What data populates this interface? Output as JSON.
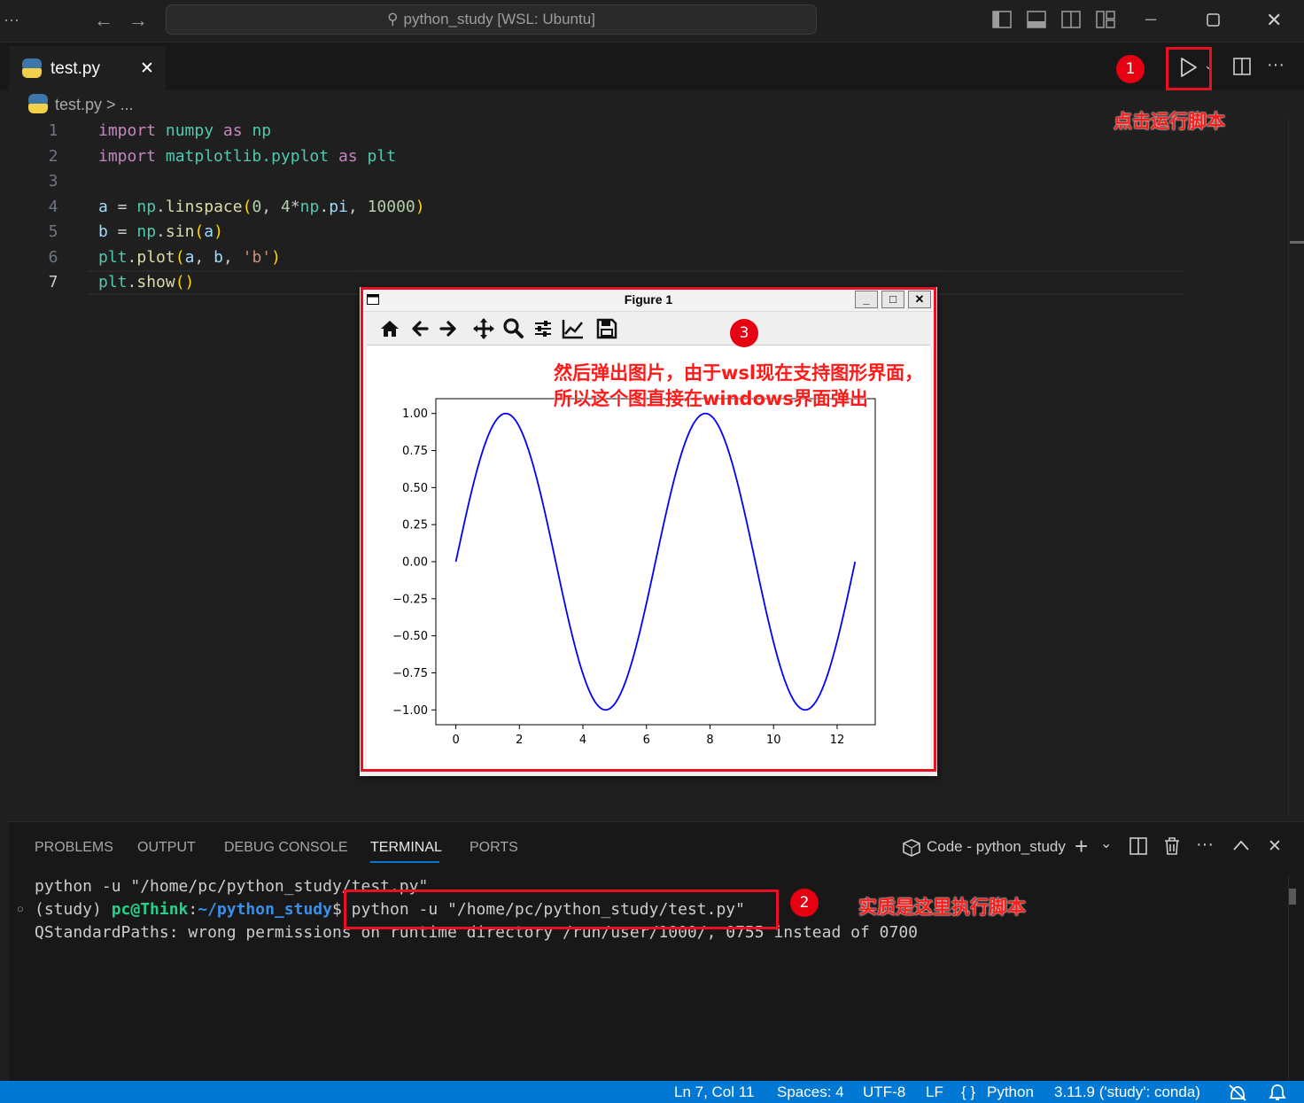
{
  "titlebar": {
    "command_center": "python_study [WSL: Ubuntu]",
    "back_icon": "arrow-left-icon",
    "forward_icon": "arrow-right-icon"
  },
  "tab": {
    "label": "test.py",
    "close": "✕"
  },
  "breadcrumb": {
    "file": "test.py",
    "sep": ">",
    "more": "..."
  },
  "editor": {
    "line_numbers": [
      "1",
      "2",
      "3",
      "4",
      "5",
      "6",
      "7"
    ]
  },
  "annotations": {
    "badge1": "1",
    "badge2": "2",
    "badge3": "3",
    "note1": "点击运行脚本",
    "note2": "实质是这里执行脚本",
    "note3_line1": "然后弹出图片，由于wsl现在支持图形界面，",
    "note3_line2": "所以这个图直接在windows界面弹出"
  },
  "figure": {
    "title": "Figure 1",
    "minimize": "_",
    "maximize": "□",
    "close": "✕"
  },
  "chart_data": {
    "type": "line",
    "title": "",
    "xlabel": "",
    "ylabel": "",
    "xlim": [
      -0.63,
      13.2
    ],
    "ylim": [
      -1.1,
      1.1
    ],
    "x_ticks": [
      "0",
      "2",
      "4",
      "6",
      "8",
      "10",
      "12"
    ],
    "y_ticks": [
      "1.00",
      "0.75",
      "0.50",
      "0.25",
      "0.00",
      "−0.25",
      "−0.50",
      "−0.75",
      "−1.00"
    ],
    "series": [
      {
        "function": "sin(x)",
        "x_range": [
          0,
          12.566
        ],
        "points": 10000,
        "color": "#0000ff"
      }
    ]
  },
  "panel": {
    "tabs": [
      "PROBLEMS",
      "OUTPUT",
      "DEBUG CONSOLE",
      "TERMINAL",
      "PORTS"
    ],
    "active_tab": "TERMINAL",
    "terminal_name": "Code - python_study",
    "plus": "+",
    "chevron": "⌄",
    "more": "···",
    "up": "^",
    "close": "✕"
  },
  "terminal": {
    "line1": "python -u \"/home/pc/python_study/test.py\"",
    "prompt_env": "(study) ",
    "prompt_user": "pc@Think",
    "prompt_colon": ":",
    "prompt_path": "~/python_study",
    "prompt_dollar": "$ ",
    "command": "python -u \"/home/pc/python_study/test.py\"",
    "line3": "QStandardPaths: wrong permissions on runtime directory /run/user/1000/, 0755 instead of 0700"
  },
  "statusbar": {
    "position": "Ln 7, Col 11",
    "spaces": "Spaces: 4",
    "encoding": "UTF-8",
    "eol": "LF",
    "language_icon": "{ }",
    "language": "Python",
    "interpreter": "3.11.9 ('study': conda)"
  },
  "colors": {
    "accent": "#0078d4",
    "annotation_red": "#e81123",
    "line_blue": "#0000ff"
  }
}
